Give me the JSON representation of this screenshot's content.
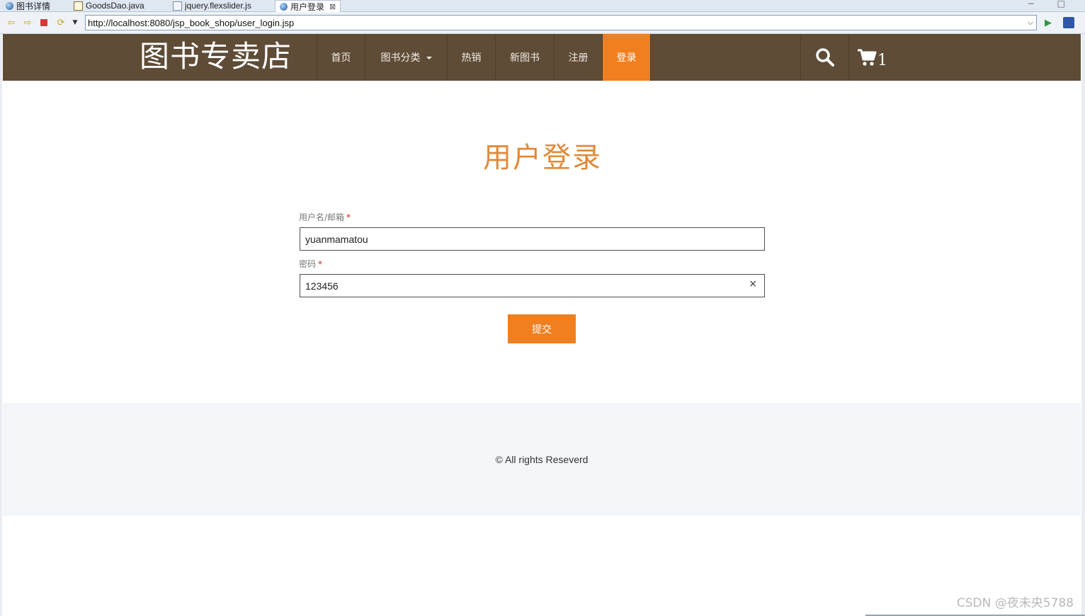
{
  "ide_tabs": [
    {
      "label": "图书详情",
      "icon": "globe-icon"
    },
    {
      "label": "GoodsDao.java",
      "icon": "java-file-icon"
    },
    {
      "label": "jquery.flexslider.js",
      "icon": "js-file-icon"
    },
    {
      "label": "用户登录",
      "icon": "globe-icon",
      "active": true
    }
  ],
  "window_controls": "− □",
  "browser": {
    "url": "http://localhost:8080/jsp_book_shop/user_login.jsp"
  },
  "site": {
    "brand": "图书专卖店",
    "nav": [
      {
        "label": "首页"
      },
      {
        "label": "图书分类",
        "dropdown": true
      },
      {
        "label": "热销"
      },
      {
        "label": "新图书"
      },
      {
        "label": "注册"
      },
      {
        "label": "登录",
        "active": true
      }
    ],
    "cart_count": "1",
    "accent": "#f07f1f",
    "nav_bg": "#5e4c37"
  },
  "login": {
    "title": "用户登录",
    "username_label": "用户名/邮箱",
    "username_value": "yuanmamatou",
    "password_label": "密码",
    "password_value": "123456",
    "required_mark": "*",
    "clear_symbol": "×",
    "submit_label": "提交"
  },
  "footer": {
    "copyright": "© All rights Reseverd"
  },
  "watermark": "CSDN @夜未央5788"
}
